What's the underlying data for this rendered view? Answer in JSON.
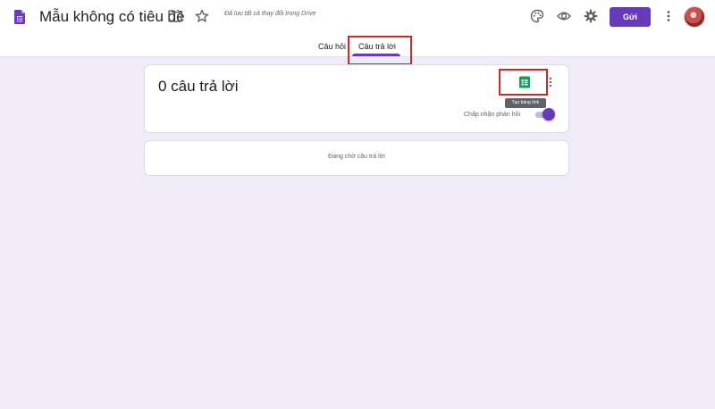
{
  "header": {
    "title": "Mẫu không có tiêu đề",
    "saved_status": "Đã lưu tất cả thay đổi trong Drive",
    "send_label": "Gửi"
  },
  "tabs": [
    {
      "label": "Câu hỏi",
      "selected": false
    },
    {
      "label": "Câu trả lời",
      "selected": true
    }
  ],
  "responses": {
    "count_label": "0 câu trả lời",
    "create_sheet_tooltip": "Tạo bảng tính",
    "accepting_label": "Chấp nhận phản hồi",
    "accepting": true,
    "waiting_label": "Đang chờ câu trả lời"
  },
  "colors": {
    "accent": "#673ab7",
    "background": "#f0ebf8",
    "sheets_green": "#0f9d58",
    "highlight_box": "#d6251e"
  },
  "icons": {
    "app": "google-forms-icon",
    "folder": "folder-icon",
    "star": "star-icon",
    "palette": "palette-icon",
    "preview": "eye-icon",
    "settings": "gear-icon",
    "more": "more-vert-icon",
    "sheets": "google-sheets-icon"
  }
}
